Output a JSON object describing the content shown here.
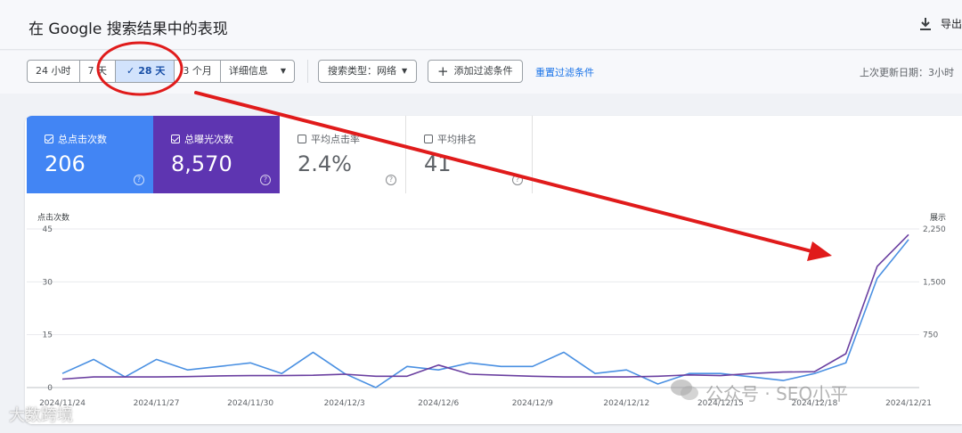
{
  "header": {
    "title": "在 Google 搜索结果中的表现",
    "export_label": "导出"
  },
  "filters": {
    "time_options": [
      "24 小时",
      "7 天",
      "28 天",
      "3 个月"
    ],
    "selected_time": "28 天",
    "more_label": "详细信息",
    "search_type": "搜索类型：网络",
    "add_filter": "添加过滤条件",
    "reset": "重置过滤条件",
    "last_updated": "上次更新日期：3小时"
  },
  "metrics": {
    "clicks": {
      "label": "总点击次数",
      "value": "206",
      "checked": true,
      "color": "#4285f4"
    },
    "impressions": {
      "label": "总曝光次数",
      "value": "8,570",
      "checked": true,
      "color": "#5e35b1"
    },
    "ctr": {
      "label": "平均点击率",
      "value": "2.4%",
      "checked": false
    },
    "position": {
      "label": "平均排名",
      "value": "41",
      "checked": false
    },
    "help_glyph": "?"
  },
  "chart_data": {
    "type": "line",
    "left_axis_title": "点击次数",
    "right_axis_title": "展示",
    "left_ticks": [
      "45",
      "30",
      "15",
      "0"
    ],
    "right_ticks": [
      "2,250",
      "1,500",
      "750"
    ],
    "ylim_left": [
      0,
      45
    ],
    "ylim_right": [
      0,
      2250
    ],
    "x_tick_labels": [
      "2024/11/24",
      "2024/11/27",
      "2024/11/30",
      "2024/12/3",
      "2024/12/6",
      "2024/12/9",
      "2024/12/12",
      "2024/12/15",
      "2024/12/18",
      "2024/12/21"
    ],
    "x": [
      "2024/11/24",
      "2024/11/25",
      "2024/11/26",
      "2024/11/27",
      "2024/11/28",
      "2024/11/29",
      "2024/11/30",
      "2024/12/1",
      "2024/12/2",
      "2024/12/3",
      "2024/12/4",
      "2024/12/5",
      "2024/12/6",
      "2024/12/7",
      "2024/12/8",
      "2024/12/9",
      "2024/12/10",
      "2024/12/11",
      "2024/12/12",
      "2024/12/13",
      "2024/12/14",
      "2024/12/15",
      "2024/12/16",
      "2024/12/17",
      "2024/12/18",
      "2024/12/19",
      "2024/12/20",
      "2024/12/21"
    ],
    "series": [
      {
        "name": "总点击次数",
        "axis": "left",
        "color": "#4a90e2",
        "values": [
          4,
          8,
          3,
          8,
          5,
          6,
          7,
          4,
          10,
          4,
          0,
          6,
          5,
          7,
          6,
          6,
          10,
          4,
          5,
          1,
          4,
          4,
          3,
          2,
          4,
          7,
          31,
          42
        ]
      },
      {
        "name": "总曝光次数",
        "axis": "right",
        "color": "#6a3fa0",
        "values": [
          120,
          150,
          150,
          150,
          155,
          165,
          170,
          170,
          175,
          190,
          160,
          160,
          320,
          190,
          175,
          160,
          150,
          150,
          150,
          160,
          180,
          170,
          200,
          220,
          225,
          480,
          1720,
          2170
        ]
      }
    ],
    "grid": true
  },
  "annotations": {
    "circle_color": "#e01b1b",
    "arrow_color": "#e01b1b"
  },
  "watermarks": {
    "wechat": "公众号 · SEO小平",
    "corner": "大数跨境"
  }
}
